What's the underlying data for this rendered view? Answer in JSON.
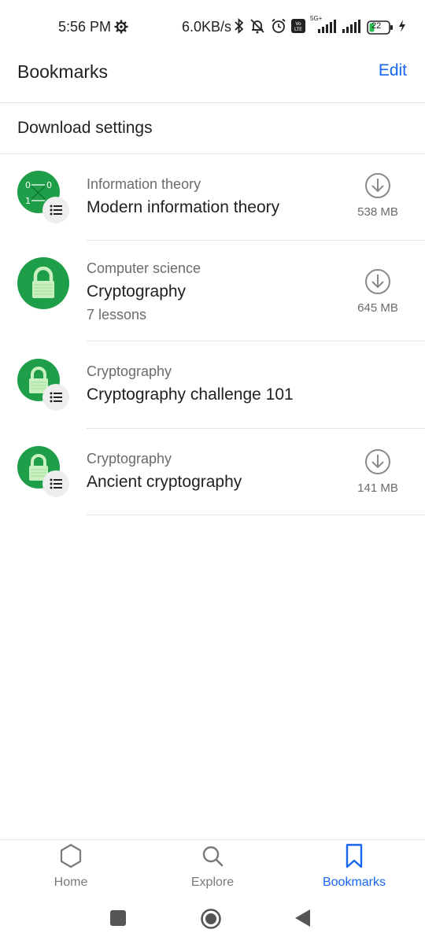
{
  "status_bar": {
    "time": "5:56 PM",
    "net_speed": "6.0KB/s",
    "battery": "22",
    "network_tag": "5G+"
  },
  "header": {
    "title": "Bookmarks",
    "edit_label": "Edit"
  },
  "download_settings": "Download settings",
  "bookmarks": [
    {
      "subtitle": "Information theory",
      "title": "Modern information theory",
      "meta": "",
      "size": "538 MB",
      "icon": "information-theory-thumbnail"
    },
    {
      "subtitle": "Computer science",
      "title": "Cryptography",
      "meta": "7 lessons",
      "size": "645 MB",
      "icon": "padlock-thumbnail"
    },
    {
      "subtitle": "Cryptography",
      "title": "Cryptography challenge 101",
      "meta": "",
      "size": "",
      "icon": "padlock-thumbnail"
    },
    {
      "subtitle": "Cryptography",
      "title": "Ancient cryptography",
      "meta": "",
      "size": "141 MB",
      "icon": "padlock-thumbnail"
    }
  ],
  "tabs": [
    {
      "label": "Home",
      "icon": "hexagon-icon",
      "active": false
    },
    {
      "label": "Explore",
      "icon": "search-icon",
      "active": false
    },
    {
      "label": "Bookmarks",
      "icon": "bookmark-icon",
      "active": true
    }
  ],
  "colors": {
    "accent": "#1865f2",
    "thumbnail_green": "#1f9e4a",
    "text_secondary": "#6b6b6b"
  }
}
